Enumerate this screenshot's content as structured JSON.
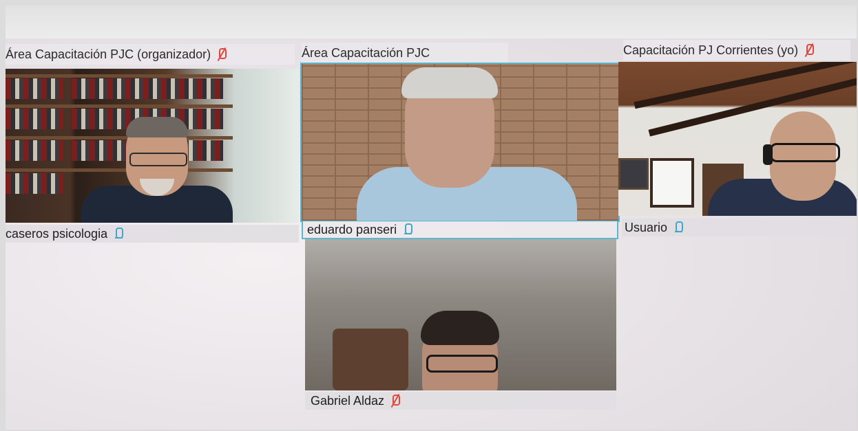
{
  "tiles": [
    {
      "header": "Área Capacitación PJC (organizador)",
      "header_mic": "muted",
      "footer": "caseros psicologia",
      "footer_mic": "on"
    },
    {
      "header": "Área Capacitación PJC",
      "footer": "eduardo panseri",
      "footer_mic": "on"
    },
    {
      "header": "Capacitación PJ Corrientes (yo)",
      "header_mic": "muted",
      "footer": "Usuario",
      "footer_mic": "on"
    },
    {
      "footer": "Gabriel Aldaz",
      "footer_mic": "muted"
    }
  ],
  "colors": {
    "muted_mic": "#e0463e",
    "active_mic": "#3fa7c9",
    "active_speaker_border": "#5bb6cf"
  }
}
